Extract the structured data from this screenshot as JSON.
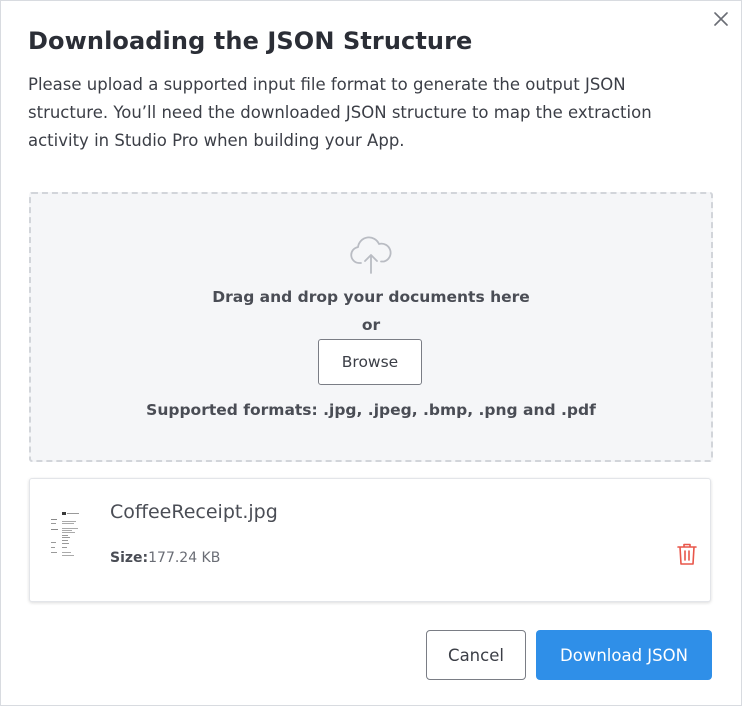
{
  "dialog": {
    "title": "Downloading the JSON Structure",
    "description": "Please upload a supported input file format to generate the output JSON structure. You’ll need the downloaded JSON structure to map the extraction activity in Studio Pro when building your App.",
    "close_icon": "close-icon"
  },
  "dropzone": {
    "icon": "cloud-upload-icon",
    "drag_text": "Drag and drop your documents here",
    "or_text": "or",
    "browse_label": "Browse",
    "formats_text": "Supported formats: .jpg, .jpeg, .bmp, .png and .pdf"
  },
  "file": {
    "name": "CoffeeReceipt.jpg",
    "size_label": "Size:",
    "size_value": "177.24 KB",
    "thumbnail_icon": "receipt-thumbnail",
    "delete_icon": "trash-icon"
  },
  "footer": {
    "cancel_label": "Cancel",
    "download_label": "Download JSON"
  },
  "colors": {
    "primary": "#2f8fe8",
    "delete": "#e8564a",
    "dropzone_bg": "#f5f6f8",
    "border": "#d2d5da"
  }
}
